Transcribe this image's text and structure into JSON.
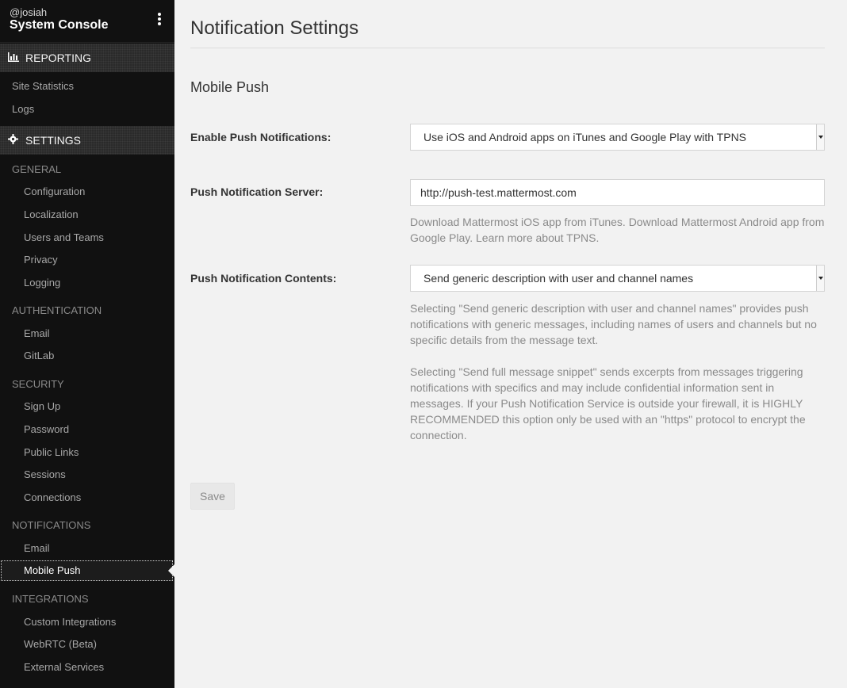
{
  "sidebar": {
    "username": "@josiah",
    "console_title": "System Console",
    "reporting_label": "REPORTING",
    "reporting_items": [
      "Site Statistics",
      "Logs"
    ],
    "settings_label": "SETTINGS",
    "groups": {
      "general": {
        "label": "GENERAL",
        "items": [
          "Configuration",
          "Localization",
          "Users and Teams",
          "Privacy",
          "Logging"
        ]
      },
      "authentication": {
        "label": "AUTHENTICATION",
        "items": [
          "Email",
          "GitLab"
        ]
      },
      "security": {
        "label": "SECURITY",
        "items": [
          "Sign Up",
          "Password",
          "Public Links",
          "Sessions",
          "Connections"
        ]
      },
      "notifications": {
        "label": "NOTIFICATIONS",
        "items": [
          "Email",
          "Mobile Push"
        ]
      },
      "integrations": {
        "label": "INTEGRATIONS",
        "items": [
          "Custom Integrations",
          "WebRTC (Beta)",
          "External Services"
        ]
      }
    },
    "active_item": "Mobile Push"
  },
  "main": {
    "title": "Notification Settings",
    "section_title": "Mobile Push",
    "enable_push": {
      "label": "Enable Push Notifications:",
      "value": "Use iOS and Android apps on iTunes and Google Play with TPNS"
    },
    "push_server": {
      "label": "Push Notification Server:",
      "value": "http://push-test.mattermost.com",
      "help": "Download Mattermost iOS app from iTunes. Download Mattermost Android app from Google Play. Learn more about TPNS."
    },
    "push_contents": {
      "label": "Push Notification Contents:",
      "value": "Send generic description with user and channel names",
      "help1": "Selecting \"Send generic description with user and channel names\" provides push notifications with generic messages, including names of users and channels but no specific details from the message text.",
      "help2": "Selecting \"Send full message snippet\" sends excerpts from messages triggering notifications with specifics and may include confidential information sent in messages. If your Push Notification Service is outside your firewall, it is HIGHLY RECOMMENDED this option only be used with an \"https\" protocol to encrypt the connection."
    },
    "save_label": "Save"
  },
  "colors": {
    "sidebar_bg": "#111111",
    "page_bg": "#f2f2f2",
    "help_text": "#8a8a8a"
  },
  "icons": {
    "reporting": "bar-chart-icon",
    "settings": "gear-icon",
    "menu": "vertical-dots-icon"
  }
}
